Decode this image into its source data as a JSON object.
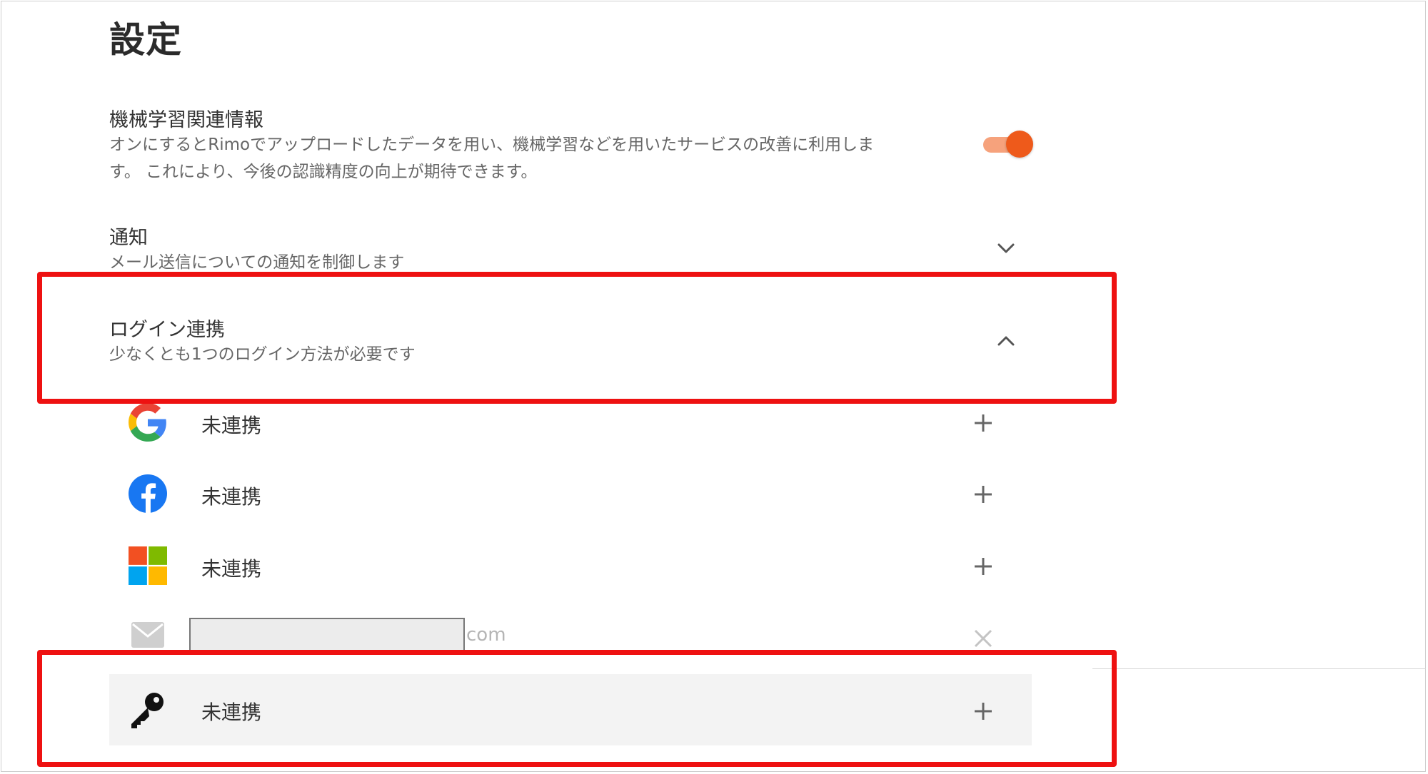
{
  "header": {
    "title": "設定"
  },
  "ml_info": {
    "title": "機械学習関連情報",
    "description_line1": "オンにするとRimoでアップロードしたデータを用い、機械学習などを用いたサービスの改善に利用しま",
    "description_line2": "す。 これにより、今後の認識精度の向上が期待できます。",
    "toggle_on": true,
    "toggle_color": "#ee5a1b"
  },
  "notification": {
    "title": "通知",
    "description": "メール送信についての通知を制御します",
    "expanded": false
  },
  "login_link": {
    "title": "ログイン連携",
    "description": "少なくとも1つのログイン方法が必要です",
    "expanded": true,
    "providers": [
      {
        "icon": "google-icon",
        "status": "未連携",
        "action": "add"
      },
      {
        "icon": "facebook-icon",
        "status": "未連携",
        "action": "add"
      },
      {
        "icon": "microsoft-icon",
        "status": "未連携",
        "action": "add"
      },
      {
        "icon": "mail-icon",
        "email_suffix": "com",
        "action": "remove"
      },
      {
        "icon": "key-icon",
        "status": "未連携",
        "action": "add"
      }
    ]
  },
  "highlight_color": "#ee1111"
}
